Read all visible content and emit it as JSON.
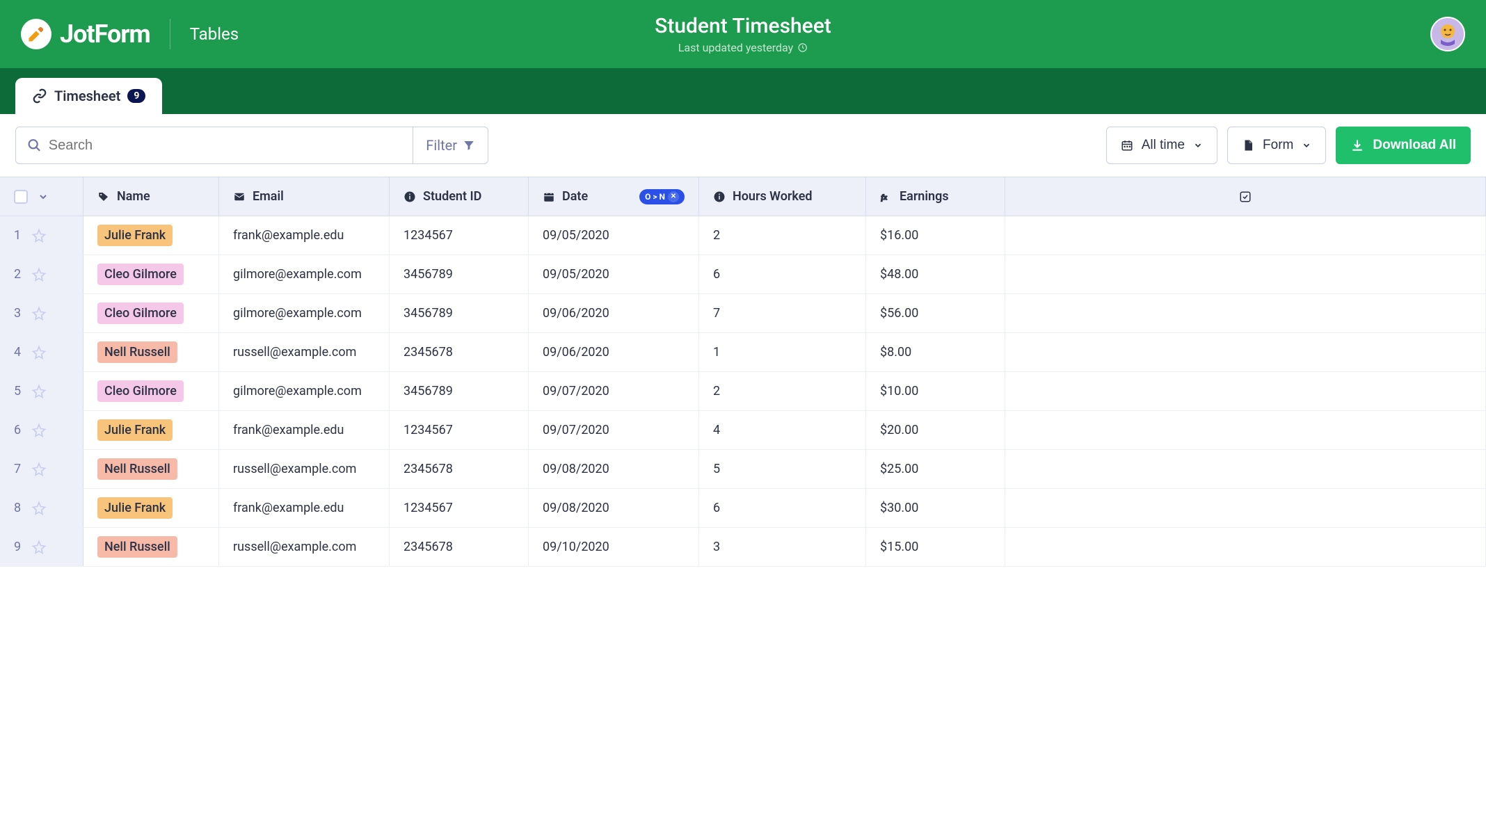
{
  "header": {
    "brand": "JotForm",
    "section": "Tables",
    "title": "Student Timesheet",
    "subtitle": "Last updated yesterday"
  },
  "tab": {
    "label": "Timesheet",
    "count": "9"
  },
  "toolbar": {
    "search_placeholder": "Search",
    "filter_label": "Filter",
    "time_label": "All time",
    "form_label": "Form",
    "download_label": "Download All"
  },
  "columns": {
    "name": "Name",
    "email": "Email",
    "student_id": "Student ID",
    "date": "Date",
    "hours": "Hours Worked",
    "earnings": "Earnings",
    "sort_badge": "O > N"
  },
  "name_colors": {
    "Julie Frank": "#f8c37a",
    "Cleo Gilmore": "#f5c7e8",
    "Nell Russell": "#f7b9a8"
  },
  "rows": [
    {
      "n": "1",
      "name": "Julie Frank",
      "email": "frank@example.edu",
      "id": "1234567",
      "date": "09/05/2020",
      "hours": "2",
      "earn": "$16.00"
    },
    {
      "n": "2",
      "name": "Cleo Gilmore",
      "email": "gilmore@example.com",
      "id": "3456789",
      "date": "09/05/2020",
      "hours": "6",
      "earn": "$48.00"
    },
    {
      "n": "3",
      "name": "Cleo Gilmore",
      "email": "gilmore@example.com",
      "id": "3456789",
      "date": "09/06/2020",
      "hours": "7",
      "earn": "$56.00"
    },
    {
      "n": "4",
      "name": "Nell Russell",
      "email": "russell@example.com",
      "id": "2345678",
      "date": "09/06/2020",
      "hours": "1",
      "earn": "$8.00"
    },
    {
      "n": "5",
      "name": "Cleo Gilmore",
      "email": "gilmore@example.com",
      "id": "3456789",
      "date": "09/07/2020",
      "hours": "2",
      "earn": "$10.00"
    },
    {
      "n": "6",
      "name": "Julie Frank",
      "email": "frank@example.edu",
      "id": "1234567",
      "date": "09/07/2020",
      "hours": "4",
      "earn": "$20.00"
    },
    {
      "n": "7",
      "name": "Nell Russell",
      "email": "russell@example.com",
      "id": "2345678",
      "date": "09/08/2020",
      "hours": "5",
      "earn": "$25.00"
    },
    {
      "n": "8",
      "name": "Julie Frank",
      "email": "frank@example.edu",
      "id": "1234567",
      "date": "09/08/2020",
      "hours": "6",
      "earn": "$30.00"
    },
    {
      "n": "9",
      "name": "Nell Russell",
      "email": "russell@example.com",
      "id": "2345678",
      "date": "09/10/2020",
      "hours": "3",
      "earn": "$15.00"
    }
  ]
}
